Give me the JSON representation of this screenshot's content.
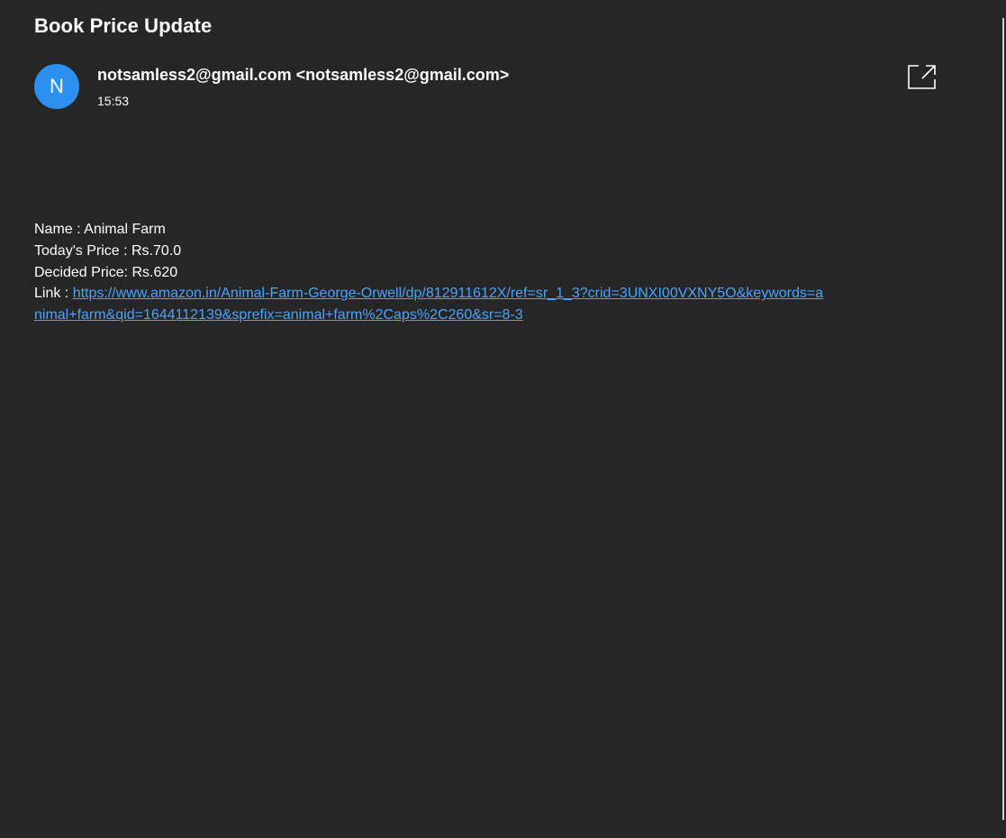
{
  "email": {
    "subject": "Book Price Update",
    "sender": {
      "avatar_initial": "N",
      "avatar_color": "#2d8ff0",
      "display": "notsamless2@gmail.com <notsamless2@gmail.com>"
    },
    "time": "15:53",
    "popout_icon": "open-in-new-window-icon"
  },
  "message": {
    "name_label": "Name : ",
    "name_value": " Animal Farm",
    "todays_price_label": "Today's Price : ",
    "todays_price_value": "Rs.70.0",
    "decided_price_label": "Decided Price: ",
    "decided_price_value": "Rs.620",
    "link_label": "Link : ",
    "link_url": "https://www.amazon.in/Animal-Farm-George-Orwell/dp/812911612X/ref=sr_1_3?crid=3UNXI00VXNY5O&keywords=animal+farm&qid=1644112139&sprefix=animal+farm%2Caps%2C260&sr=8-3"
  },
  "colors": {
    "background": "#262626",
    "link": "#4aa3ff",
    "text": "#ffffff"
  }
}
